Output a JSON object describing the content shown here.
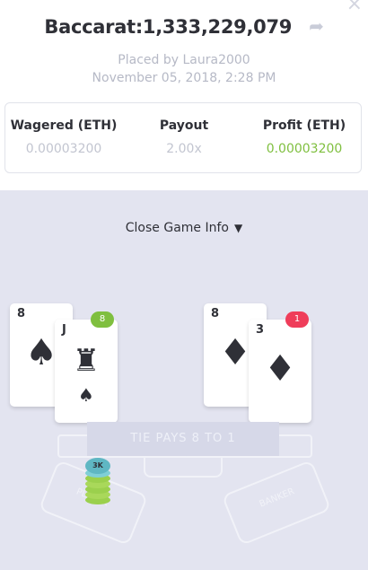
{
  "header": {
    "title": "Baccarat:1,333,229,079",
    "placed_by": "Placed by Laura2000",
    "date": "November 05, 2018, 2:28 PM"
  },
  "stats": {
    "wagered_label": "Wagered (ETH)",
    "wagered_value": "0.00003200",
    "payout_label": "Payout",
    "payout_value": "2.00x",
    "profit_label": "Profit (ETH)",
    "profit_value": "0.00003200"
  },
  "game": {
    "toggle_label": "Close Game Info",
    "player_score": "8",
    "banker_score": "1",
    "player_cards": [
      {
        "rank": "8",
        "suit": "♠"
      },
      {
        "rank": "J",
        "suit": "♠"
      }
    ],
    "banker_cards": [
      {
        "rank": "8",
        "suit": "♦"
      },
      {
        "rank": "3",
        "suit": "♦"
      }
    ],
    "tie_banner": "TIE PAYS 8 TO 1",
    "tie_label": "TIE",
    "banker_label": "BANKER",
    "player_label": "PLAYER",
    "chip_label": "3K"
  },
  "colors": {
    "green": "#7fbf3f",
    "red": "#ef3d5a",
    "teal": "#5fb7c3"
  }
}
